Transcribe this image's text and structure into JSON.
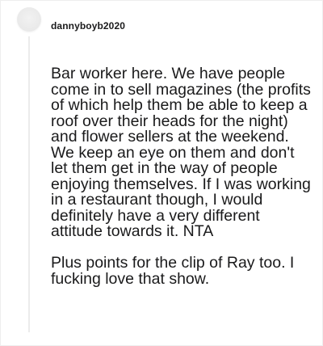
{
  "comment": {
    "username": "dannyboyb2020",
    "paragraphs": [
      "Bar worker here. We have people come in to sell magazines (the profits of which help them be able to keep a roof over their heads for the night) and flower sellers at the weekend. We keep an eye on them and don't let them get in the way of people enjoying themselves. If I was working in a restaurant though, I would definitely have a very different attitude towards it. NTA",
      "Plus points for the clip of Ray too. I fucking love that show."
    ]
  }
}
